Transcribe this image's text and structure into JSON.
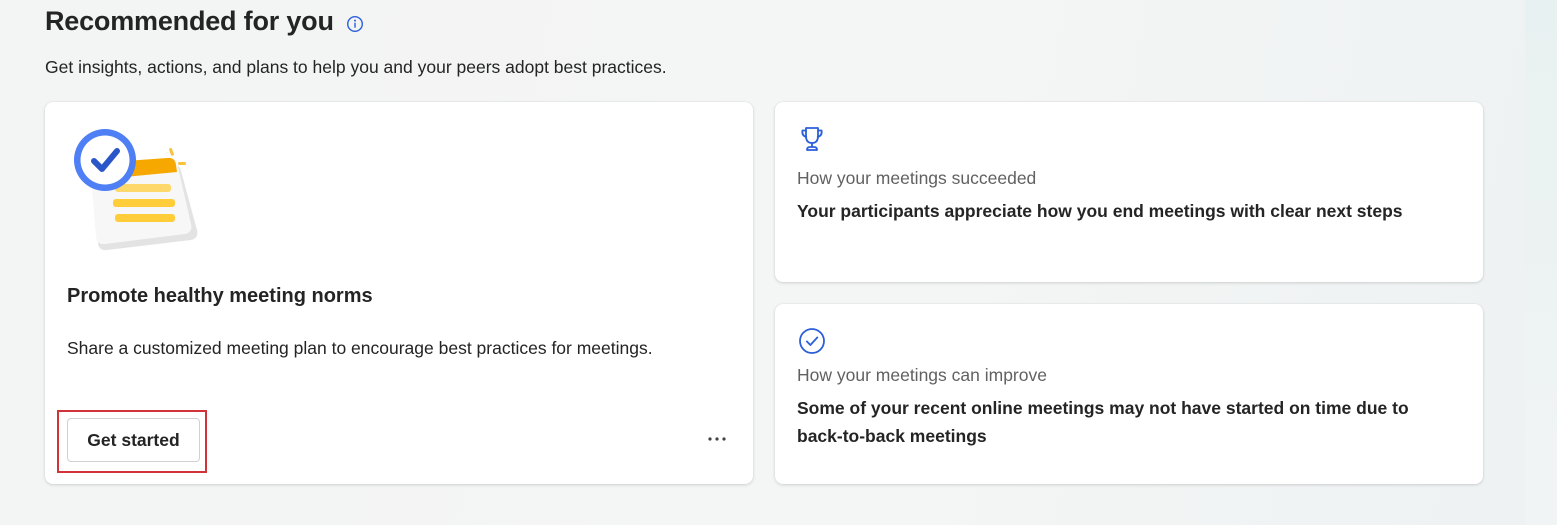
{
  "header": {
    "title": "Recommended for you",
    "info_icon": "info-icon",
    "subtitle": "Get insights, actions, and plans to help you and your peers adopt best practices."
  },
  "plan_card": {
    "illustration": "checklist-illustration",
    "title": "Promote healthy meeting norms",
    "description": "Share a customized meeting plan to encourage best practices for meetings.",
    "button_label": "Get started",
    "more_icon": "more-horizontal-icon"
  },
  "insights": [
    {
      "icon": "trophy-icon",
      "label": "How your meetings succeeded",
      "text": "Your participants appreciate how you end meetings with clear next steps"
    },
    {
      "icon": "checkmark-circle-icon",
      "label": "How your meetings can improve",
      "text": "Some of your recent online meetings may not have started on time due to back-to-back meetings"
    }
  ],
  "colors": {
    "accent": "#2b5fd9",
    "highlight_border": "#d13438",
    "illustration_yellow": "#f7c23c"
  }
}
